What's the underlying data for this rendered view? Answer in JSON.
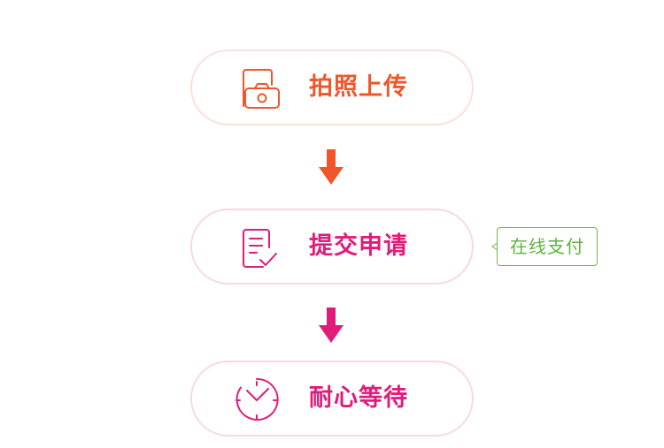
{
  "steps": [
    {
      "label": "拍照上传",
      "icon": "camera-icon"
    },
    {
      "label": "提交申请",
      "icon": "form-check-icon"
    },
    {
      "label": "耐心等待",
      "icon": "clock-icon"
    }
  ],
  "side_tag": {
    "label": "在线支付"
  },
  "arrows": [
    "arrow-down-icon",
    "arrow-down-icon"
  ],
  "colors": {
    "orange": "#f0562a",
    "pink": "#e01c7a",
    "green": "#6dbb4c"
  }
}
